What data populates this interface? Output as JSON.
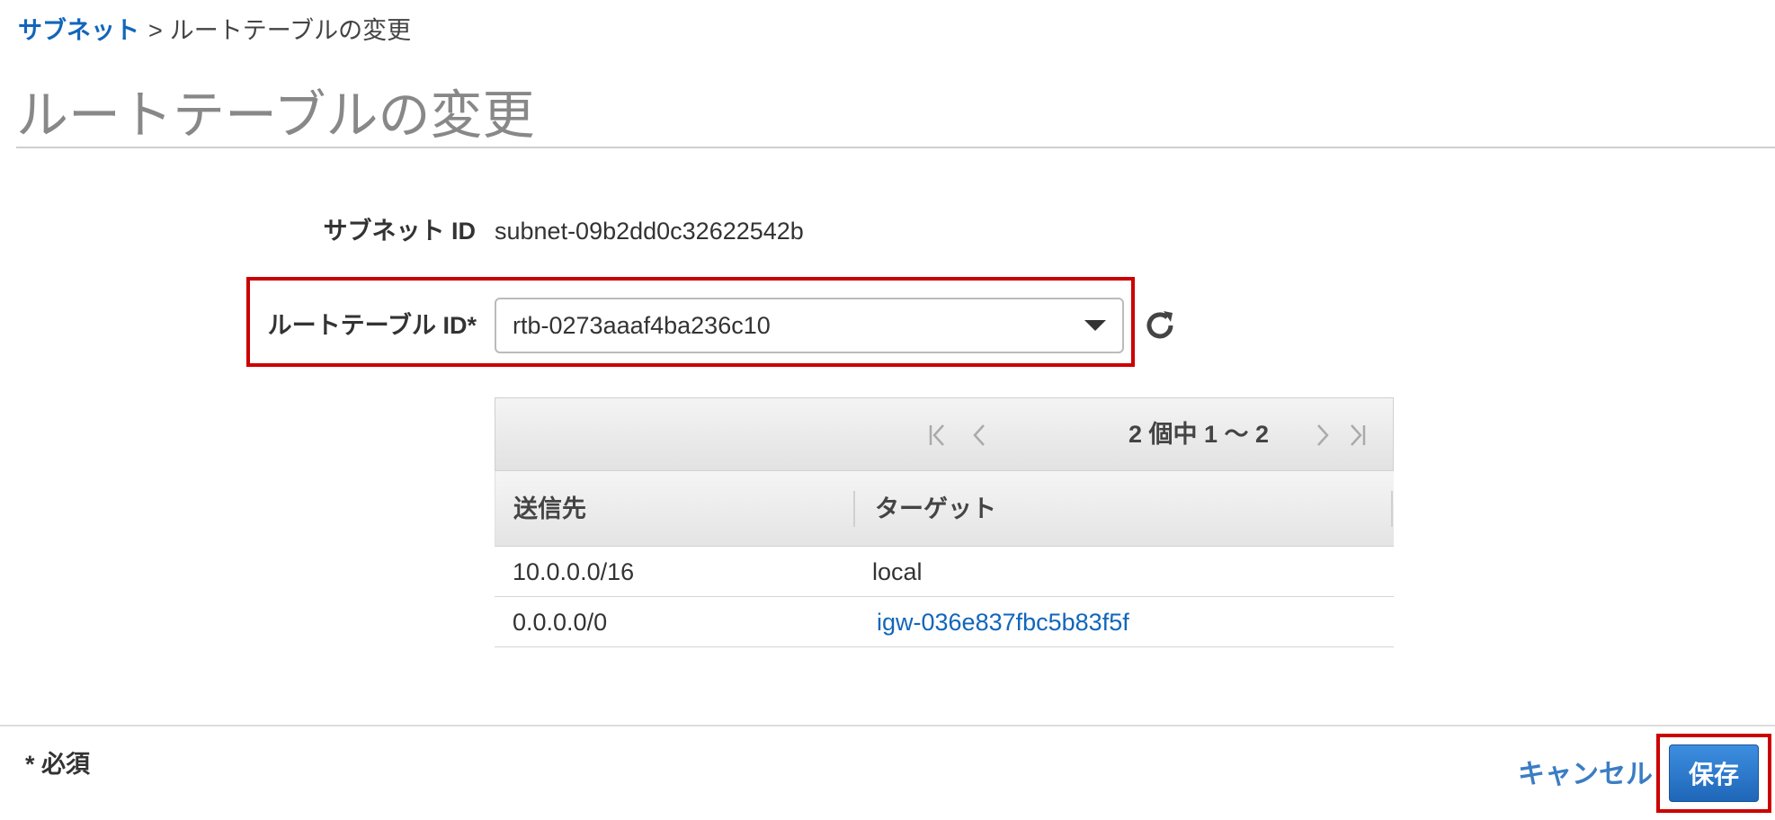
{
  "breadcrumb": {
    "parent": "サブネット",
    "separator": ">",
    "current": "ルートテーブルの変更"
  },
  "page": {
    "title": "ルートテーブルの変更"
  },
  "form": {
    "subnet_id_label": "サブネット ID",
    "subnet_id_value": "subnet-09b2dd0c32622542b",
    "route_table_label": "ルートテーブル ID*",
    "route_table_value": "rtb-0273aaaf4ba236c10"
  },
  "table": {
    "pager_text": "2 個中 1 〜 2",
    "columns": [
      "送信先",
      "ターゲット"
    ],
    "rows": [
      {
        "destination": "10.0.0.0/16",
        "target": "local"
      },
      {
        "destination": "0.0.0.0/0",
        "target": "igw-036e837fbc5b83f5f"
      }
    ]
  },
  "footer": {
    "required_note": "* 必須",
    "cancel_label": "キャンセル",
    "save_label": "保存"
  },
  "icons": {
    "refresh": "refresh-icon",
    "select_arrow": "caret-down-icon",
    "first_page": "first-page-icon",
    "prev_page": "prev-page-icon",
    "next_page": "next-page-icon",
    "last_page": "last-page-icon"
  },
  "colors": {
    "link": "#1166bb",
    "highlight": "#cc0000",
    "primary_button": "#2a74c8"
  }
}
